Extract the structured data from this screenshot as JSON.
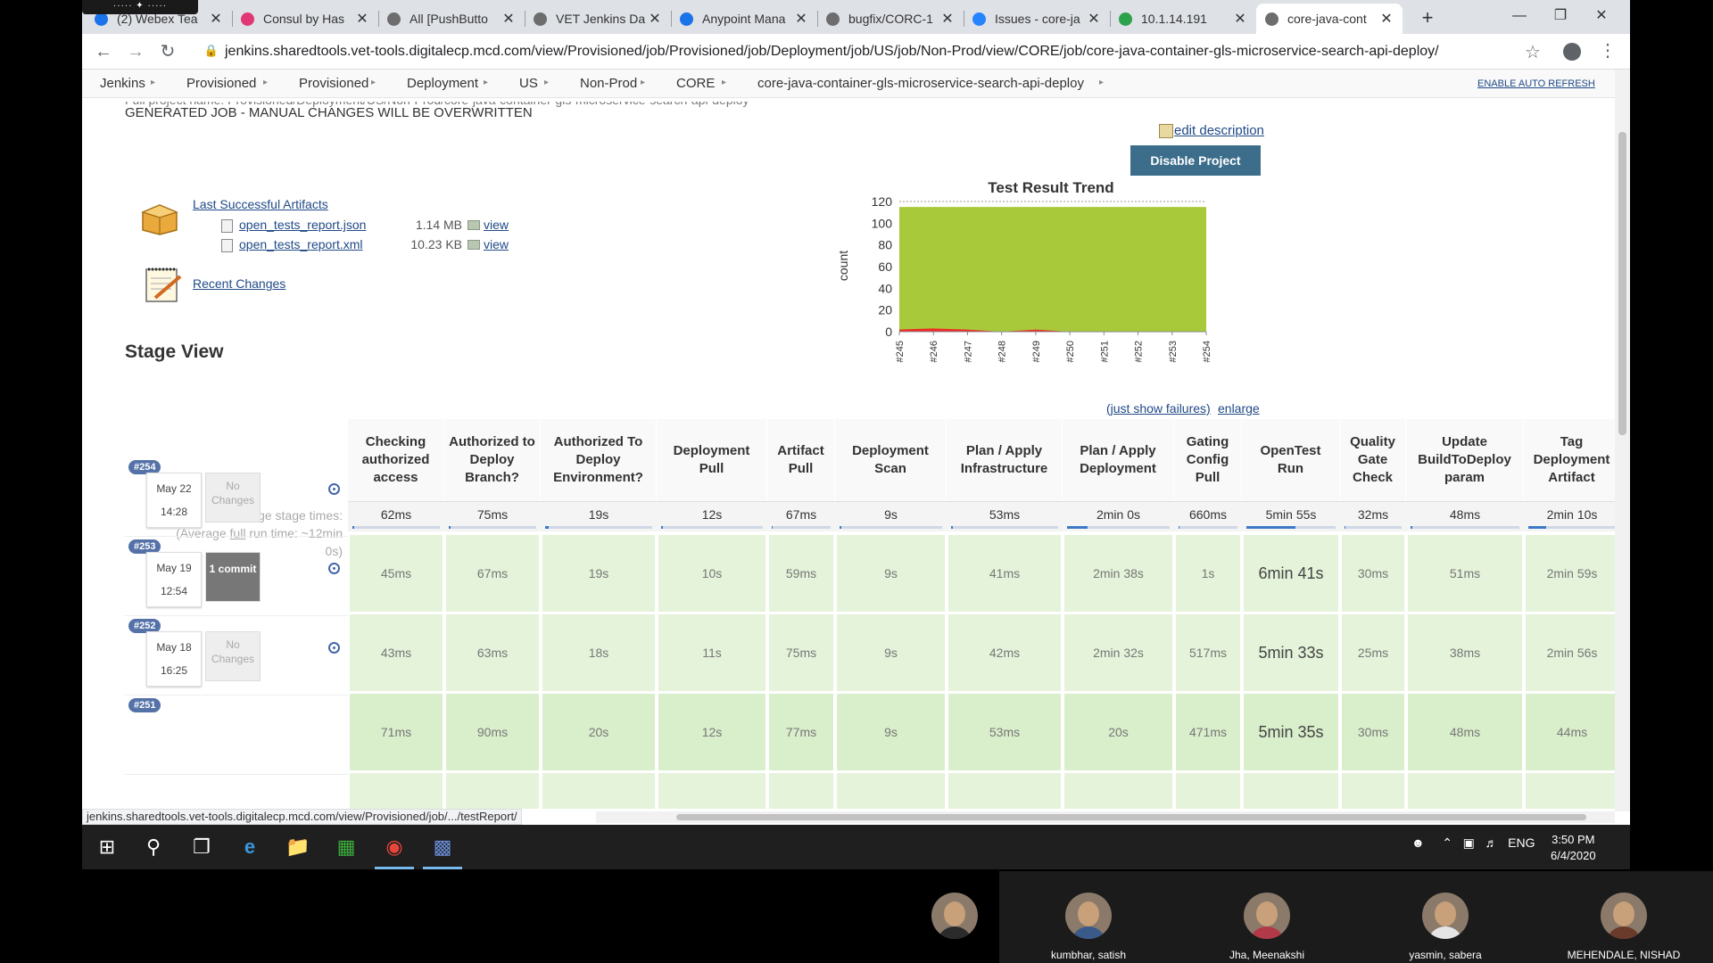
{
  "webex_bar": "····· ✦ ·····",
  "tabs": [
    {
      "title": "(2) Webex Tea",
      "icon": "webex-icon",
      "color": "#1a73e8"
    },
    {
      "title": "Consul by Has",
      "icon": "consul-icon",
      "color": "#e03875"
    },
    {
      "title": "All [PushButto",
      "icon": "jenkins-icon",
      "color": "#6d6d6d"
    },
    {
      "title": "VET Jenkins Da",
      "icon": "jenkins-icon",
      "color": "#6d6d6d"
    },
    {
      "title": "Anypoint Mana",
      "icon": "mulesoft-icon",
      "color": "#1a73e8"
    },
    {
      "title": "bugfix/CORC-1",
      "icon": "jenkins-icon",
      "color": "#6d6d6d"
    },
    {
      "title": "Issues - core-ja",
      "icon": "jira-icon",
      "color": "#2684ff"
    },
    {
      "title": "10.1.14.191",
      "icon": "consul-icon",
      "color": "#2ca24c"
    },
    {
      "title": "core-java-cont",
      "icon": "jenkins-icon",
      "color": "#6d6d6d"
    }
  ],
  "address": {
    "url": "jenkins.sharedtools.vet-tools.digitalecp.mcd.com/view/Provisioned/job/Provisioned/job/Deployment/job/US/job/Non-Prod/view/CORE/job/core-java-container-gls-microservice-search-api-deploy/"
  },
  "breadcrumbs": [
    "Jenkins",
    "Provisioned",
    "Provisioned",
    "Deployment",
    "US",
    "Non-Prod",
    "CORE",
    "core-java-container-gls-microservice-search-api-deploy"
  ],
  "enable_auto_refresh": "ENABLE AUTO REFRESH",
  "page": {
    "cut_text": "Full project name: Provisioned/Deployment/US/Non-Prod/core-java-container-gls-microservice-search-api-deploy",
    "generated_note": "GENERATED JOB - MANUAL CHANGES WILL BE OVERWRITTEN",
    "edit_description": "edit description",
    "disable_project": "Disable Project",
    "last_successful_artifacts": "Last Successful Artifacts",
    "artifacts": [
      {
        "name": "open_tests_report.json",
        "size": "1.14 MB",
        "view": "view"
      },
      {
        "name": "open_tests_report.xml",
        "size": "10.23 KB",
        "view": "view"
      }
    ],
    "recent_changes": "Recent Changes",
    "stage_view": "Stage View",
    "just_show_failures": "(just show failures)",
    "enlarge": "enlarge"
  },
  "chart_data": {
    "type": "area",
    "title": "Test Result Trend",
    "ylabel": "count",
    "xlabel": "",
    "ylim": [
      0,
      120
    ],
    "yticks": [
      0,
      20,
      40,
      60,
      80,
      100,
      120
    ],
    "categories": [
      "#245",
      "#246",
      "#247",
      "#248",
      "#249",
      "#250",
      "#251",
      "#252",
      "#253",
      "#254"
    ],
    "series": [
      {
        "name": "",
        "color": "#a8c93a",
        "values": [
          115,
          115,
          115,
          115,
          115,
          115,
          115,
          115,
          115,
          115
        ]
      },
      {
        "name": "",
        "color": "#ef2929",
        "values": [
          2,
          3,
          2,
          0,
          2,
          0,
          0,
          0,
          0,
          0
        ]
      }
    ]
  },
  "stage_table": {
    "avg_label_1": "Average stage times:",
    "avg_label_2": "(Average ",
    "avg_label_link": "full",
    "avg_label_3": " run time: ~12min",
    "avg_label_4": "0s)",
    "stages": [
      {
        "name": "Checking authorized access",
        "avg": "62ms",
        "fill": 0.02
      },
      {
        "name": "Authorized to Deploy Branch?",
        "avg": "75ms",
        "fill": 0.02
      },
      {
        "name": "Authorized To Deploy Environment?",
        "avg": "19s",
        "fill": 0.03
      },
      {
        "name": "Deployment Pull",
        "avg": "12s",
        "fill": 0.02
      },
      {
        "name": "Artifact Pull",
        "avg": "67ms",
        "fill": 0.02
      },
      {
        "name": "Deployment Scan",
        "avg": "9s",
        "fill": 0.02
      },
      {
        "name": "Plan / Apply Infrastructure",
        "avg": "53ms",
        "fill": 0.02
      },
      {
        "name": "Plan / Apply Deployment",
        "avg": "2min 0s",
        "fill": 0.2
      },
      {
        "name": "Gating Config Pull",
        "avg": "660ms",
        "fill": 0.02
      },
      {
        "name": "OpenTest Run",
        "avg": "5min 55s",
        "fill": 0.55
      },
      {
        "name": "Quality Gate Check",
        "avg": "32ms",
        "fill": 0.02
      },
      {
        "name": "Update BuildToDeploy param",
        "avg": "48ms",
        "fill": 0.02
      },
      {
        "name": "Tag Deployment Artifact",
        "avg": "2min 10s",
        "fill": 0.2
      }
    ],
    "builds": [
      {
        "id": "#254",
        "date": "May 22",
        "time": "14:28",
        "changes": "No Changes",
        "commit": false,
        "times": [
          "45ms",
          "67ms",
          "19s",
          "10s",
          "59ms",
          "9s",
          "41ms",
          "2min 38s",
          "1s",
          "6min 41s",
          "30ms",
          "51ms",
          "2min 59s"
        ]
      },
      {
        "id": "#253",
        "date": "May 19",
        "time": "12:54",
        "changes": "1 commit",
        "commit": true,
        "times": [
          "43ms",
          "63ms",
          "18s",
          "11s",
          "75ms",
          "9s",
          "42ms",
          "2min 32s",
          "517ms",
          "5min 33s",
          "25ms",
          "38ms",
          "2min 56s"
        ]
      },
      {
        "id": "#252",
        "date": "May 18",
        "time": "16:25",
        "changes": "No Changes",
        "commit": false,
        "times": [
          "71ms",
          "90ms",
          "20s",
          "12s",
          "77ms",
          "9s",
          "53ms",
          "20s",
          "471ms",
          "5min 35s",
          "30ms",
          "48ms",
          "44ms"
        ]
      },
      {
        "id": "#251"
      }
    ]
  },
  "status_url": "jenkins.sharedtools.vet-tools.digitalecp.mcd.com/view/Provisioned/job/.../testReport/",
  "taskbar": {
    "tray_lang": "ENG",
    "time": "3:50 PM",
    "date": "6/4/2020"
  },
  "participants": [
    {
      "name": ""
    },
    {
      "name": "kumbhar, satish"
    },
    {
      "name": "Jha, Meenakshi"
    },
    {
      "name": "yasmin, sabera"
    },
    {
      "name": "MEHENDALE, NISHAD"
    }
  ]
}
